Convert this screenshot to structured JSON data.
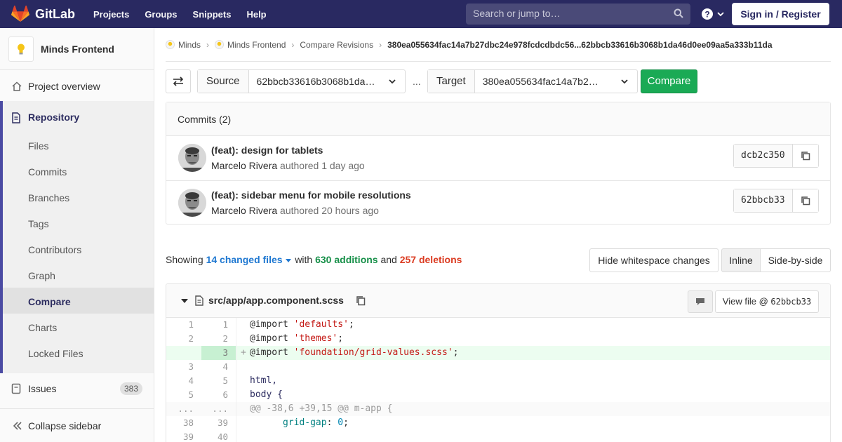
{
  "navbar": {
    "brand": "GitLab",
    "links": [
      "Projects",
      "Groups",
      "Snippets",
      "Help"
    ],
    "search_placeholder": "Search or jump to…",
    "signin": "Sign in / Register"
  },
  "sidebar": {
    "project_name": "Minds Frontend",
    "overview": "Project overview",
    "repository": "Repository",
    "sub_items": [
      "Files",
      "Commits",
      "Branches",
      "Tags",
      "Contributors",
      "Graph",
      "Compare",
      "Charts",
      "Locked Files"
    ],
    "issues": "Issues",
    "issues_count": "383",
    "collapse": "Collapse sidebar"
  },
  "breadcrumb": {
    "items": [
      "Minds",
      "Minds Frontend",
      "Compare Revisions"
    ],
    "current": "380ea055634fac14a7b27dbc24e978fcdcdbdc56...62bbcb33616b3068b1da46d0ee09aa5a333b11da"
  },
  "compare": {
    "source_label": "Source",
    "source_value": "62bbcb33616b3068b1da…",
    "separator": "...",
    "target_label": "Target",
    "target_value": "380ea055634fac14a7b2…",
    "button": "Compare"
  },
  "commits": {
    "header": "Commits (2)",
    "items": [
      {
        "title": "(feat): design for tablets",
        "author": "Marcelo Rivera",
        "verb": "authored",
        "time": "1 day ago",
        "sha": "dcb2c350"
      },
      {
        "title": "(feat): sidebar menu for mobile resolutions",
        "author": "Marcelo Rivera",
        "verb": "authored",
        "time": "20 hours ago",
        "sha": "62bbcb33"
      }
    ]
  },
  "stats": {
    "showing": "Showing",
    "changed": "14 changed files",
    "with": "with",
    "additions": "630 additions",
    "and": "and",
    "deletions": "257 deletions"
  },
  "view_buttons": {
    "whitespace": "Hide whitespace changes",
    "inline": "Inline",
    "side": "Side-by-side"
  },
  "file": {
    "path": "src/app/app.component.scss",
    "view_file": "View file @",
    "view_sha": "62bbcb33",
    "lines": [
      {
        "old": "1",
        "new": "1",
        "type": "ctx"
      },
      {
        "old": "2",
        "new": "2",
        "type": "ctx"
      },
      {
        "old": "",
        "new": "3",
        "type": "add"
      },
      {
        "old": "3",
        "new": "4",
        "type": "ctx"
      },
      {
        "old": "4",
        "new": "5",
        "type": "ctx"
      },
      {
        "old": "5",
        "new": "6",
        "type": "ctx"
      },
      {
        "old": "...",
        "new": "...",
        "type": "match"
      },
      {
        "old": "38",
        "new": "39",
        "type": "ctx"
      },
      {
        "old": "39",
        "new": "40",
        "type": "ctx"
      }
    ],
    "code": {
      "l1_kw": "@import",
      "l1_str": "'defaults'",
      "l2_kw": "@import",
      "l2_str": "'themes'",
      "l3_kw": "@import",
      "l3_str": "'foundation/grid-values.scss'",
      "l5": "html,",
      "l6": "body {",
      "hunk": "@@ -38,6 +39,15 @@ m-app {",
      "l39_prop": "grid-gap",
      "l39_val": "0"
    }
  }
}
